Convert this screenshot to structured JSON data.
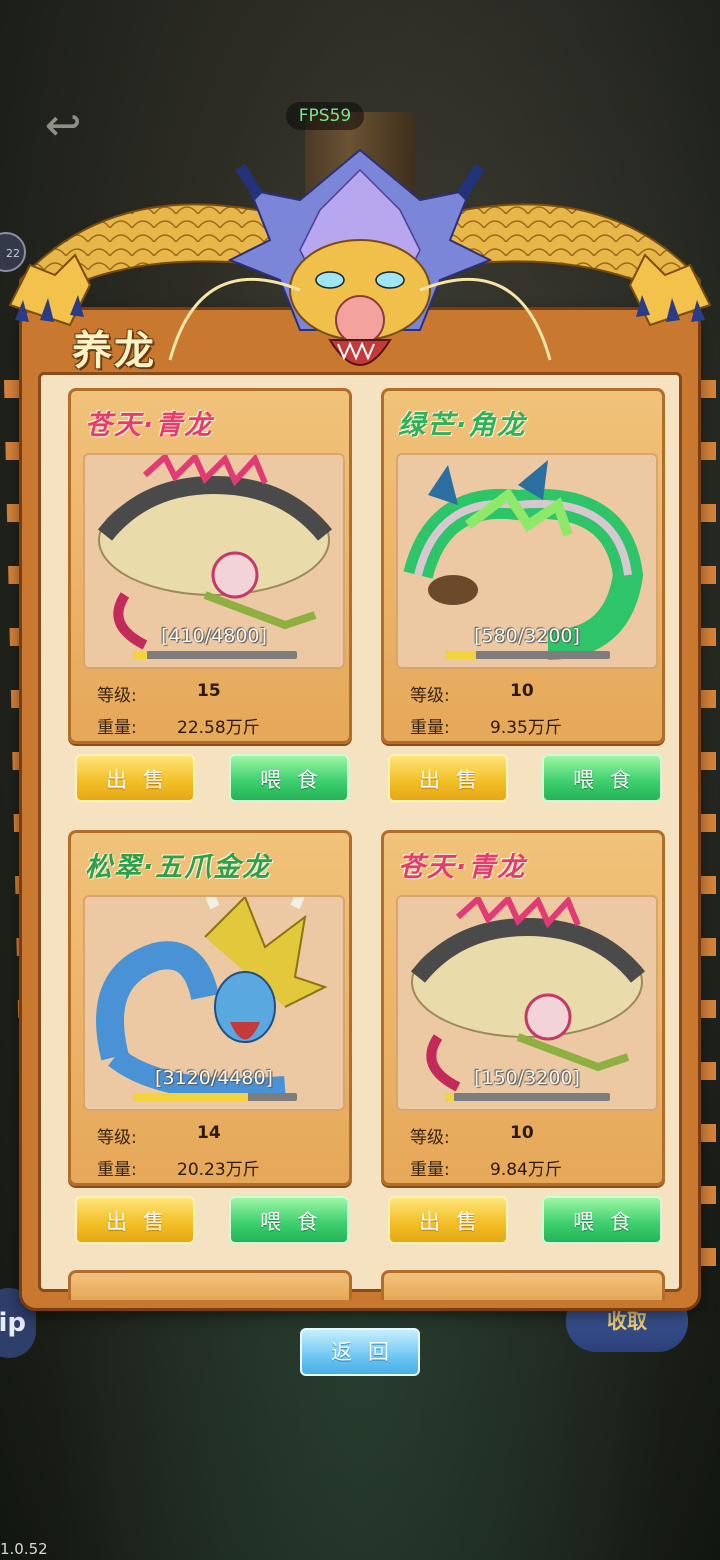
{
  "hud": {
    "fps": "FPS59",
    "left_badge": "22",
    "side_label": "ip",
    "right_badge": "收取",
    "version": "1.0.52"
  },
  "panel": {
    "title": "养龙",
    "back_label": "返回"
  },
  "dragons": [
    {
      "name": "苍天·青龙",
      "name_color": "#e63c6c",
      "progress_text": "[410/4800]",
      "progress": 0.085,
      "level_label": "等级:",
      "level": "15",
      "weight_label": "重量:",
      "weight": "22.58万斤",
      "sell_label": "出售",
      "feed_label": "喂食"
    },
    {
      "name": "绿芒·角龙",
      "name_color": "#2fb05a",
      "progress_text": "[580/3200]",
      "progress": 0.18,
      "level_label": "等级:",
      "level": "10",
      "weight_label": "重量:",
      "weight": "9.35万斤",
      "sell_label": "出售",
      "feed_label": "喂食"
    },
    {
      "name": "松翠·五爪金龙",
      "name_color": "#2e9f4a",
      "progress_text": "[3120/4480]",
      "progress": 0.7,
      "level_label": "等级:",
      "level": "14",
      "weight_label": "重量:",
      "weight": "20.23万斤",
      "sell_label": "出售",
      "feed_label": "喂食"
    },
    {
      "name": "苍天·青龙",
      "name_color": "#e63c6c",
      "progress_text": "[150/3200]",
      "progress": 0.047,
      "level_label": "等级:",
      "level": "10",
      "weight_label": "重量:",
      "weight": "9.84万斤",
      "sell_label": "出售",
      "feed_label": "喂食"
    }
  ]
}
